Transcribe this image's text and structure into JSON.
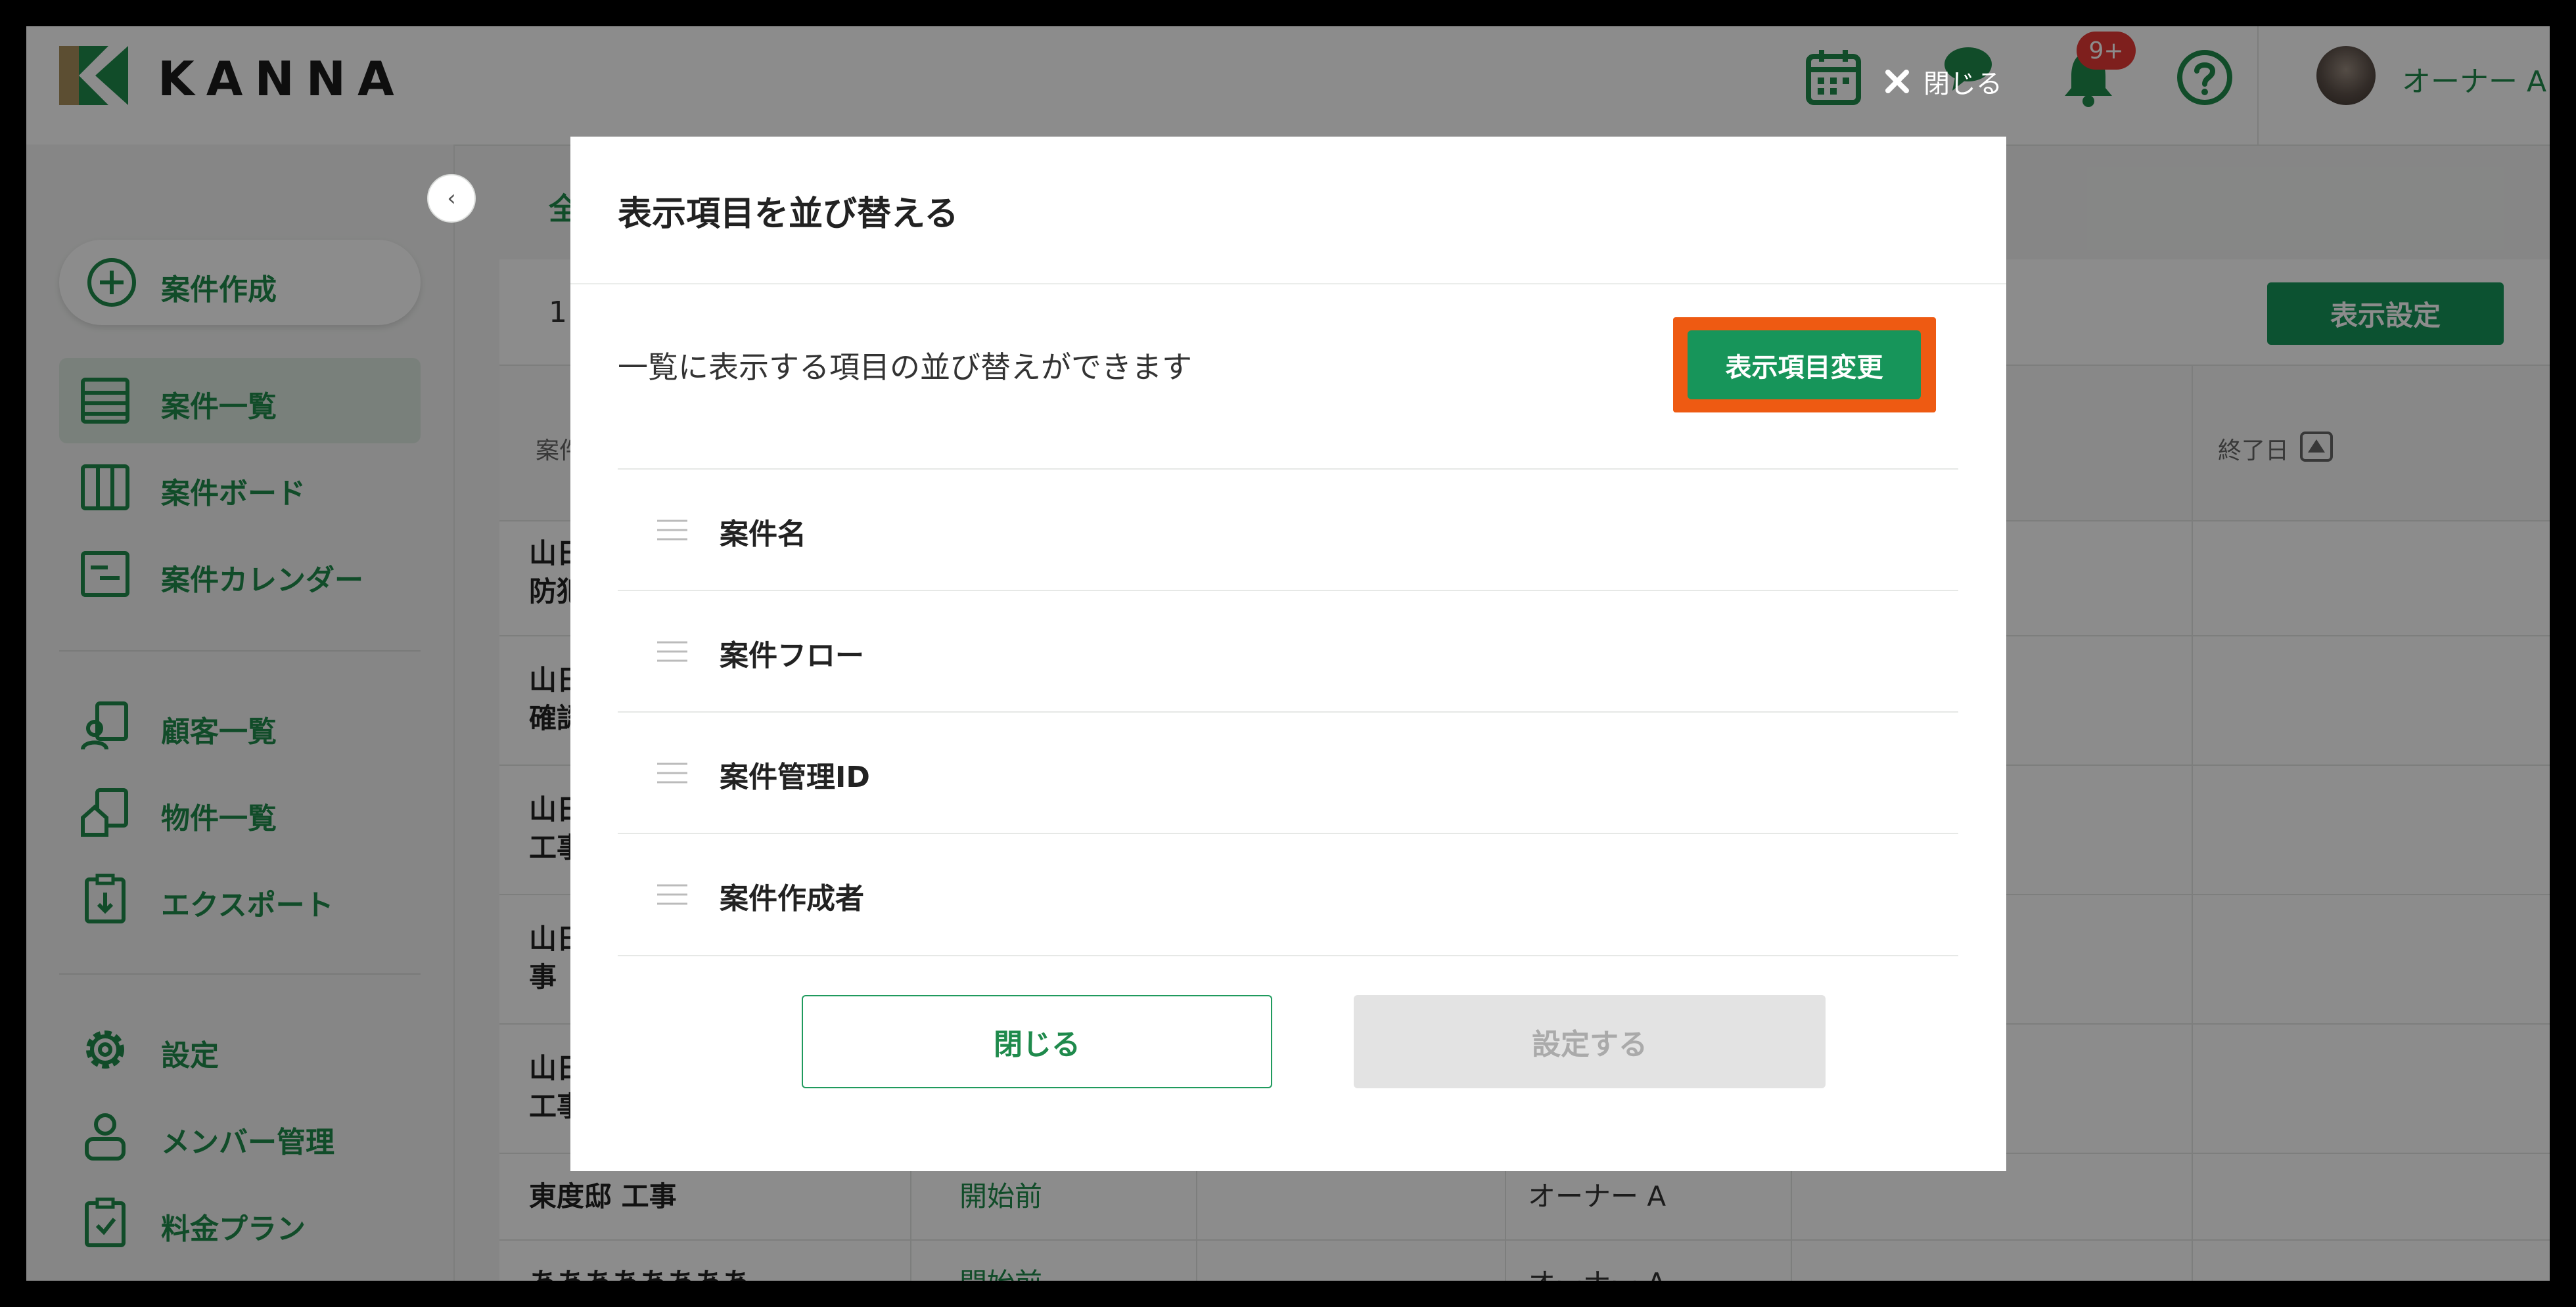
{
  "app": {
    "logo_text": "KANNA"
  },
  "header": {
    "notification_badge": "9+",
    "user_name": "オーナー A",
    "icons": [
      "calendar-icon",
      "chat-icon",
      "bell-icon",
      "help-icon"
    ]
  },
  "sidebar": {
    "create_label": "案件作成",
    "items": [
      {
        "label": "案件一覧",
        "icon": "list-icon",
        "active": true
      },
      {
        "label": "案件ボード",
        "icon": "board-icon",
        "active": false
      },
      {
        "label": "案件カレンダー",
        "icon": "calendar-list-icon",
        "active": false
      },
      {
        "label": "顧客一覧",
        "icon": "customer-icon",
        "active": false
      },
      {
        "label": "物件一覧",
        "icon": "house-icon",
        "active": false
      },
      {
        "label": "エクスポート",
        "icon": "export-icon",
        "active": false
      },
      {
        "label": "設定",
        "icon": "gear-icon",
        "active": false
      },
      {
        "label": "メンバー管理",
        "icon": "person-icon",
        "active": false
      },
      {
        "label": "料金プラン",
        "icon": "plan-icon",
        "active": false
      }
    ]
  },
  "main": {
    "breadcrumb": "全",
    "count": "1",
    "display_settings_label": "表示設定",
    "columns": {
      "name": "案件",
      "end_date": "終了日"
    },
    "rows": [
      {
        "name_line1": "山日",
        "name_line2": "防犯"
      },
      {
        "name_line1": "山日",
        "name_line2": "確認"
      },
      {
        "name_line1": "山日",
        "name_line2": "工事"
      },
      {
        "name_line1": "山日",
        "name_line2": "事"
      },
      {
        "name_line1": "山日",
        "name_line2": "工事"
      },
      {
        "name_line1": "東度邸 工事",
        "status": "開始前",
        "owner": "オーナー A"
      },
      {
        "name_line1": "ああああああああ",
        "status": "開始前",
        "owner": "オーナー A"
      }
    ]
  },
  "overlay": {
    "close_label": "閉じる"
  },
  "modal": {
    "title": "表示項目を並び替える",
    "description": "一覧に表示する項目の並び替えができます",
    "change_button": "表示項目変更",
    "items": [
      "案件名",
      "案件フロー",
      "案件管理ID",
      "案件作成者"
    ],
    "close_button": "閉じる",
    "submit_button": "設定する"
  },
  "colors": {
    "brand_green": "#17955a",
    "highlight_orange": "#ee5a12",
    "badge_red": "#e53935"
  }
}
